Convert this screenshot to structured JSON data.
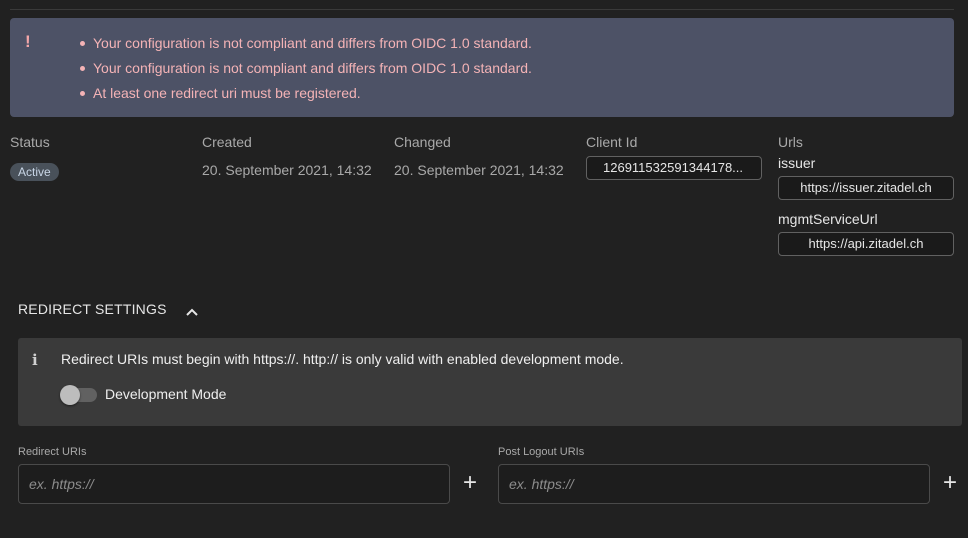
{
  "warnings": {
    "icon": "exclamation-icon",
    "items": [
      "Your configuration is not compliant and differs from OIDC 1.0 standard.",
      "Your configuration is not compliant and differs from OIDC 1.0 standard.",
      "At least one redirect uri must be registered."
    ]
  },
  "details": {
    "status_label": "Status",
    "status_value": "Active",
    "created_label": "Created",
    "created_value": "20. September 2021, 14:32",
    "changed_label": "Changed",
    "changed_value": "20. September 2021, 14:32",
    "client_id_label": "Client Id",
    "client_id_value": "126911532591344178...",
    "urls_label": "Urls",
    "urls": [
      {
        "name": "issuer",
        "value": "https://issuer.zitadel.ch"
      },
      {
        "name": "mgmtServiceUrl",
        "value": "https://api.zitadel.ch"
      }
    ]
  },
  "redirect": {
    "title": "REDIRECT SETTINGS",
    "info_text": "Redirect URIs must begin with https://. http:// is only valid with enabled development mode.",
    "dev_mode_label": "Development Mode",
    "dev_mode_enabled": false,
    "redirect_uris_label": "Redirect URIs",
    "redirect_uris_placeholder": "ex. https://",
    "post_logout_label": "Post Logout URIs",
    "post_logout_placeholder": "ex. https://",
    "add_symbol": "+"
  },
  "colors": {
    "background": "#212121",
    "warning_bg": "#4d5266",
    "warning_text": "#f4b3b6",
    "info_bg": "#3a3a3a"
  }
}
